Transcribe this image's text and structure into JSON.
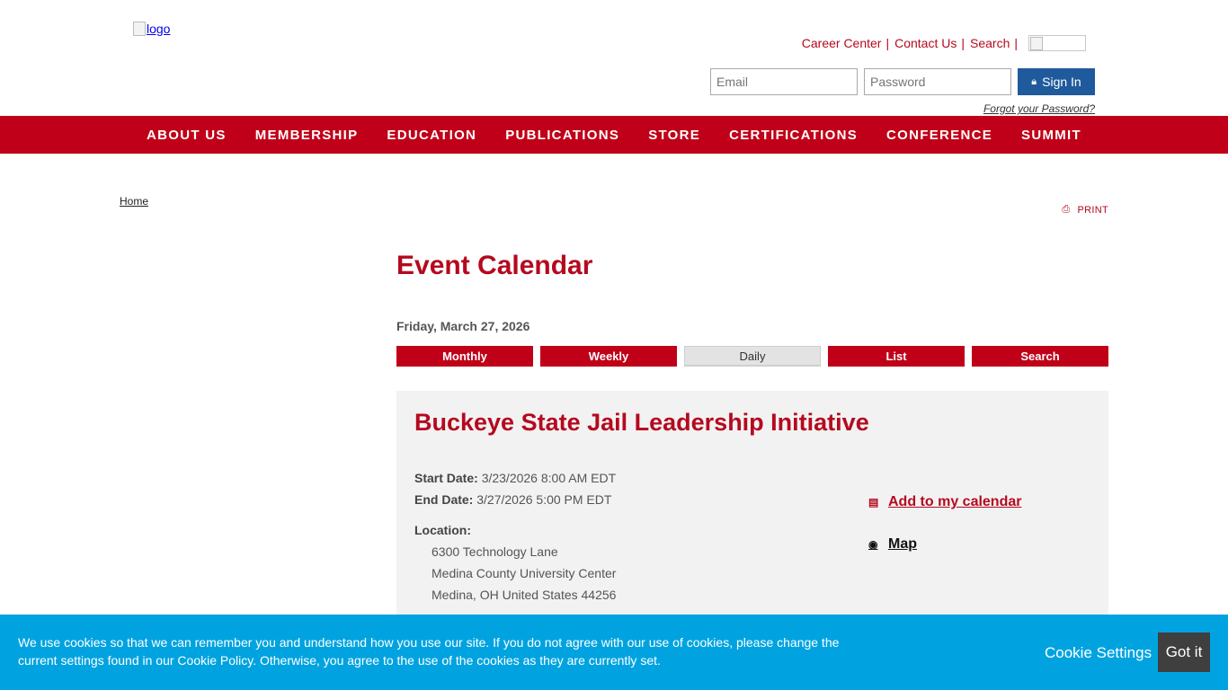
{
  "header": {
    "logo_alt": "logo",
    "links": [
      "Career Center",
      "Contact Us",
      "Search"
    ],
    "separator": "|",
    "login": {
      "email_placeholder": "Email",
      "password_placeholder": "Password",
      "sign_in_label": "Sign In",
      "sign_in_icon": "lock-icon",
      "forgot_label": "Forgot your Password?"
    }
  },
  "nav": {
    "items": [
      "ABOUT US",
      "MEMBERSHIP",
      "EDUCATION",
      "PUBLICATIONS",
      "STORE",
      "CERTIFICATIONS",
      "CONFERENCE",
      "SUMMIT"
    ],
    "background": "#c00018"
  },
  "breadcrumb": {
    "home": "Home"
  },
  "print": {
    "label": "PRINT",
    "icon": "printer-icon"
  },
  "calendar": {
    "title": "Event Calendar",
    "date": "Friday, March 27, 2026",
    "views": [
      "Monthly",
      "Weekly",
      "Daily",
      "List",
      "Search"
    ],
    "active_view": "Daily"
  },
  "event": {
    "title": "Buckeye State Jail Leadership Initiative",
    "start_label": "Start Date:",
    "start_value": "3/23/2026 8:00 AM EDT",
    "end_label": "End Date:",
    "end_value": "3/27/2026 5:00 PM EDT",
    "location_label": "Location:",
    "address": [
      "6300 Technology Lane",
      "Medina County University Center",
      "Medina, OH  United States  44256"
    ],
    "add_calendar_label": "Add to my calendar",
    "add_calendar_icon": "calendar-icon",
    "map_label": "Map",
    "map_icon": "map-marker-icon"
  },
  "cookie": {
    "text": "We use cookies so that we can remember you and understand how you use our site. If you do not agree with our use of cookies, please change the current settings found in our Cookie Policy. Otherwise, you agree to the use of the cookies as they are currently set.",
    "settings_label": "Cookie Settings",
    "accept_label": "Got it",
    "background": "#00a3e0"
  },
  "colors": {
    "brand_red": "#b5091f",
    "sign_in_blue": "#1f5a9c"
  }
}
